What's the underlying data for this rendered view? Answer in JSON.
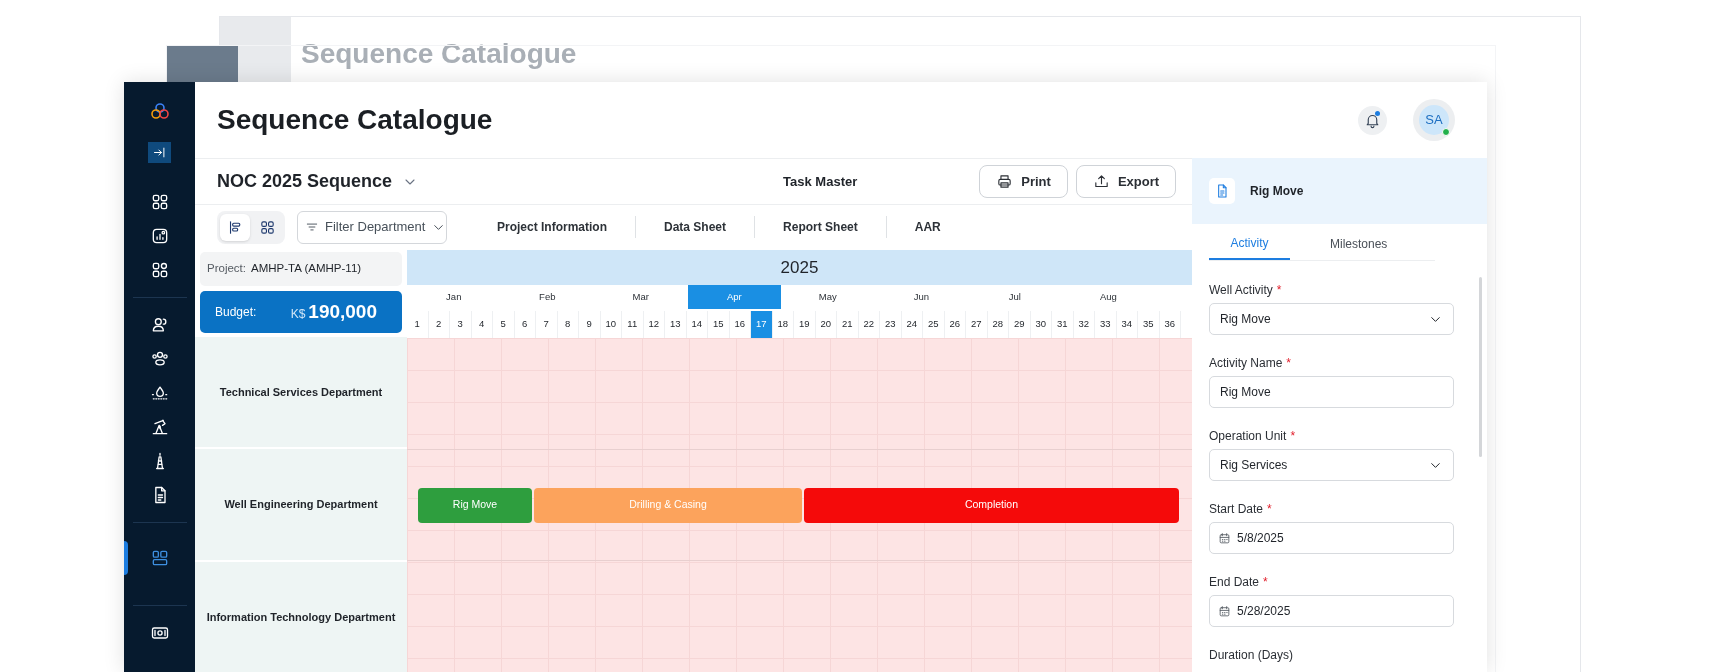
{
  "background_window": {
    "title": "Sequence Catalogue"
  },
  "sidebar": {
    "groups": [
      [
        {
          "selected": false
        },
        {
          "selected": false
        },
        {
          "selected": false
        }
      ],
      [
        {
          "selected": false
        },
        {
          "selected": false
        },
        {
          "selected": false
        },
        {
          "selected": false
        },
        {
          "selected": false
        },
        {
          "selected": false
        }
      ],
      [
        {
          "selected": true
        }
      ],
      [
        {
          "selected": false
        }
      ]
    ]
  },
  "header": {
    "title": "Sequence Catalogue",
    "avatar": "SA",
    "online": true
  },
  "sequence": {
    "name": "NOC 2025 Sequence",
    "center_label": "Task Master",
    "buttons": [
      "Print",
      "Export"
    ]
  },
  "toolbar": {
    "views": [
      {
        "selected": true
      },
      {
        "selected": false
      }
    ],
    "filter": "Filter Department",
    "tabs": [
      "Project Information",
      "Data Sheet",
      "Report Sheet",
      "AAR"
    ]
  },
  "project": {
    "label": "Project:",
    "value": "AMHP-TA (AMHP-11)"
  },
  "budget": {
    "label": "Budget:",
    "currency": "K$",
    "amount": "190,000"
  },
  "timeline": {
    "year": "2025",
    "months": [
      {
        "label": "Jan",
        "selected": false
      },
      {
        "label": "Feb",
        "selected": false
      },
      {
        "label": "Mar",
        "selected": false
      },
      {
        "label": "Apr",
        "selected": true
      },
      {
        "label": "May",
        "selected": false
      },
      {
        "label": "Jun",
        "selected": false
      },
      {
        "label": "Jul",
        "selected": false
      },
      {
        "label": "Aug",
        "selected": false
      }
    ],
    "weeks": [
      {
        "label": "1",
        "selected": false
      },
      {
        "label": "2",
        "selected": false
      },
      {
        "label": "3",
        "selected": false
      },
      {
        "label": "4",
        "selected": false
      },
      {
        "label": "5",
        "selected": false
      },
      {
        "label": "6",
        "selected": false
      },
      {
        "label": "7",
        "selected": false
      },
      {
        "label": "8",
        "selected": false
      },
      {
        "label": "9",
        "selected": false
      },
      {
        "label": "10",
        "selected": false
      },
      {
        "label": "11",
        "selected": false
      },
      {
        "label": "12",
        "selected": false
      },
      {
        "label": "13",
        "selected": false
      },
      {
        "label": "14",
        "selected": false
      },
      {
        "label": "15",
        "selected": false
      },
      {
        "label": "16",
        "selected": false
      },
      {
        "label": "17",
        "selected": true
      },
      {
        "label": "18",
        "selected": false
      },
      {
        "label": "19",
        "selected": false
      },
      {
        "label": "20",
        "selected": false
      },
      {
        "label": "21",
        "selected": false
      },
      {
        "label": "22",
        "selected": false
      },
      {
        "label": "23",
        "selected": false
      },
      {
        "label": "24",
        "selected": false
      },
      {
        "label": "25",
        "selected": false
      },
      {
        "label": "26",
        "selected": false
      },
      {
        "label": "27",
        "selected": false
      },
      {
        "label": "28",
        "selected": false
      },
      {
        "label": "29",
        "selected": false
      },
      {
        "label": "30",
        "selected": false
      },
      {
        "label": "31",
        "selected": false
      },
      {
        "label": "32",
        "selected": false
      },
      {
        "label": "33",
        "selected": false
      },
      {
        "label": "34",
        "selected": false
      },
      {
        "label": "35",
        "selected": false
      },
      {
        "label": "36",
        "selected": false
      }
    ]
  },
  "departments": [
    {
      "name": "Technical Services Department"
    },
    {
      "name": "Well Engineering Department",
      "activities": [
        {
          "label": "Rig Move",
          "color": "#2e9e3e"
        },
        {
          "label": "Drilling & Casing",
          "color": "#fca35c"
        },
        {
          "label": "Completion",
          "color": "#f50a0a"
        }
      ]
    },
    {
      "name": "Information Technology Department"
    }
  ],
  "panel": {
    "title": "Rig Move",
    "tabs": [
      {
        "label": "Activity",
        "selected": true
      },
      {
        "label": "Milestones",
        "selected": false
      }
    ],
    "fields": [
      {
        "kind": "select",
        "label": "Well Activity",
        "required_mark": "*",
        "value": "Rig Move"
      },
      {
        "kind": "text",
        "label": "Activity Name",
        "required_mark": "*",
        "value": "Rig Move"
      },
      {
        "kind": "select",
        "label": "Operation Unit",
        "required_mark": "*",
        "value": "Rig Services"
      },
      {
        "kind": "date",
        "label": "Start Date",
        "required_mark": "*",
        "value": "5/8/2025"
      },
      {
        "kind": "date",
        "label": "End Date",
        "required_mark": "*",
        "value": "5/28/2025"
      },
      {
        "kind": "label",
        "label": "Duration (Days)"
      }
    ]
  }
}
